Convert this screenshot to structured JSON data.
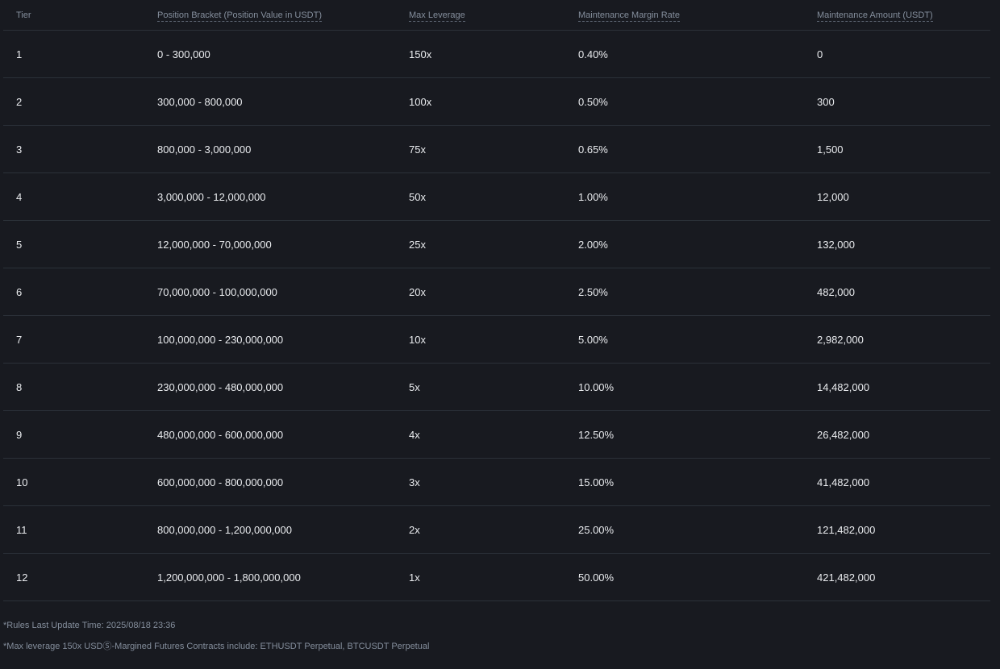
{
  "headers": {
    "tier": "Tier",
    "bracket": "Position Bracket (Position Value in USDT)",
    "leverage": "Max Leverage",
    "mmr": "Maintenance Margin Rate",
    "amount": "Maintenance Amount (USDT)"
  },
  "rows": [
    {
      "tier": "1",
      "bracket": "0 - 300,000",
      "leverage": "150x",
      "mmr": "0.40%",
      "amount": "0"
    },
    {
      "tier": "2",
      "bracket": "300,000 - 800,000",
      "leverage": "100x",
      "mmr": "0.50%",
      "amount": "300"
    },
    {
      "tier": "3",
      "bracket": "800,000 - 3,000,000",
      "leverage": "75x",
      "mmr": "0.65%",
      "amount": "1,500"
    },
    {
      "tier": "4",
      "bracket": "3,000,000 - 12,000,000",
      "leverage": "50x",
      "mmr": "1.00%",
      "amount": "12,000"
    },
    {
      "tier": "5",
      "bracket": "12,000,000 - 70,000,000",
      "leverage": "25x",
      "mmr": "2.00%",
      "amount": "132,000"
    },
    {
      "tier": "6",
      "bracket": "70,000,000 - 100,000,000",
      "leverage": "20x",
      "mmr": "2.50%",
      "amount": "482,000"
    },
    {
      "tier": "7",
      "bracket": "100,000,000 - 230,000,000",
      "leverage": "10x",
      "mmr": "5.00%",
      "amount": "2,982,000"
    },
    {
      "tier": "8",
      "bracket": "230,000,000 - 480,000,000",
      "leverage": "5x",
      "mmr": "10.00%",
      "amount": "14,482,000"
    },
    {
      "tier": "9",
      "bracket": "480,000,000 - 600,000,000",
      "leverage": "4x",
      "mmr": "12.50%",
      "amount": "26,482,000"
    },
    {
      "tier": "10",
      "bracket": "600,000,000 - 800,000,000",
      "leverage": "3x",
      "mmr": "15.00%",
      "amount": "41,482,000"
    },
    {
      "tier": "11",
      "bracket": "800,000,000 - 1,200,000,000",
      "leverage": "2x",
      "mmr": "25.00%",
      "amount": "121,482,000"
    },
    {
      "tier": "12",
      "bracket": "1,200,000,000 - 1,800,000,000",
      "leverage": "1x",
      "mmr": "50.00%",
      "amount": "421,482,000"
    }
  ],
  "notes": {
    "update_time": "*Rules Last Update Time: 2025/08/18 23:36",
    "leverage_note": "*Max leverage 150x USDⓈ-Margined Futures Contracts include: ETHUSDT Perpetual, BTCUSDT Perpetual"
  },
  "colors": {
    "background": "#181a20",
    "header_text": "#848e9c",
    "cell_text": "#eaecef",
    "divider": "#2b3139"
  }
}
